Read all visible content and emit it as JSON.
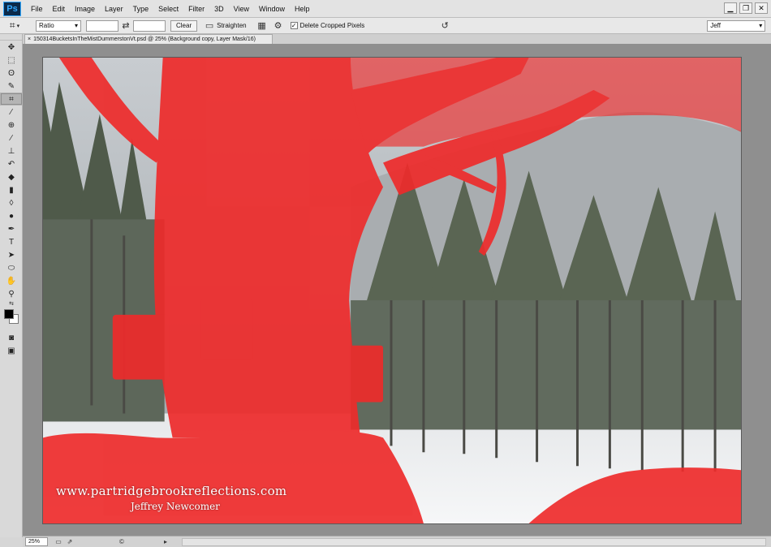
{
  "app": {
    "logo": "Ps"
  },
  "menu": [
    "File",
    "Edit",
    "Image",
    "Layer",
    "Type",
    "Select",
    "Filter",
    "3D",
    "View",
    "Window",
    "Help"
  ],
  "window_controls": {
    "minimize": "▁",
    "restore": "❐",
    "close": "✕"
  },
  "options_bar": {
    "tool_icon": "crop-icon",
    "ratio_select": "Ratio",
    "width_value": "",
    "height_value": "",
    "clear_label": "Clear",
    "straighten_label": "Straighten",
    "delete_cropped_label": "Delete Cropped Pixels",
    "delete_cropped_checked": true,
    "workspace_select": "Jeff"
  },
  "document": {
    "tab_title": "150314BucketsInTheMistDummerstonVt.psd @ 25% (Background copy, Layer Mask/16)",
    "watermark_url": "www.partridgebrookreflections.com",
    "watermark_name": "Jeffrey Newcomer"
  },
  "status": {
    "zoom": "25%"
  },
  "colors": {
    "mask_overlay": "#ff1a1a",
    "foreground": "#000000",
    "background": "#ffffff"
  }
}
